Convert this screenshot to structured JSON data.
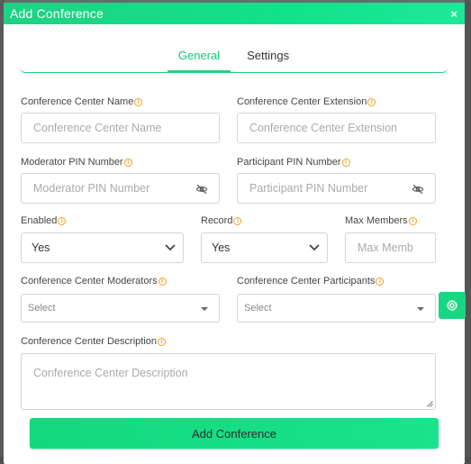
{
  "modal": {
    "title": "Add Conference",
    "close": "×"
  },
  "tabs": [
    {
      "label": "General"
    },
    {
      "label": "Settings"
    }
  ],
  "fields": {
    "center_name": {
      "label": "Conference Center Name",
      "placeholder": "Conference Center Name"
    },
    "center_extension": {
      "label": "Conference Center Extension",
      "placeholder": "Conference Center Extension"
    },
    "moderator_pin": {
      "label": "Moderator PIN Number",
      "placeholder": "Moderator PIN Number"
    },
    "participant_pin": {
      "label": "Participant PIN Number",
      "placeholder": "Participant PIN Number"
    },
    "enabled": {
      "label": "Enabled",
      "value": "Yes"
    },
    "record": {
      "label": "Record",
      "value": "Yes"
    },
    "max_members": {
      "label": "Max Members",
      "placeholder": "Max Memb"
    },
    "moderators": {
      "label": "Conference Center Moderators",
      "placeholder": "Select"
    },
    "participants": {
      "label": "Conference Center Participants",
      "placeholder": "Select"
    },
    "description": {
      "label": "Conference Center Description",
      "placeholder": "Conference Center Description"
    }
  },
  "info_glyph": "i",
  "submit_label": "Add Conference",
  "colors": {
    "accent": "#1fd183",
    "info": "#f0a020"
  }
}
